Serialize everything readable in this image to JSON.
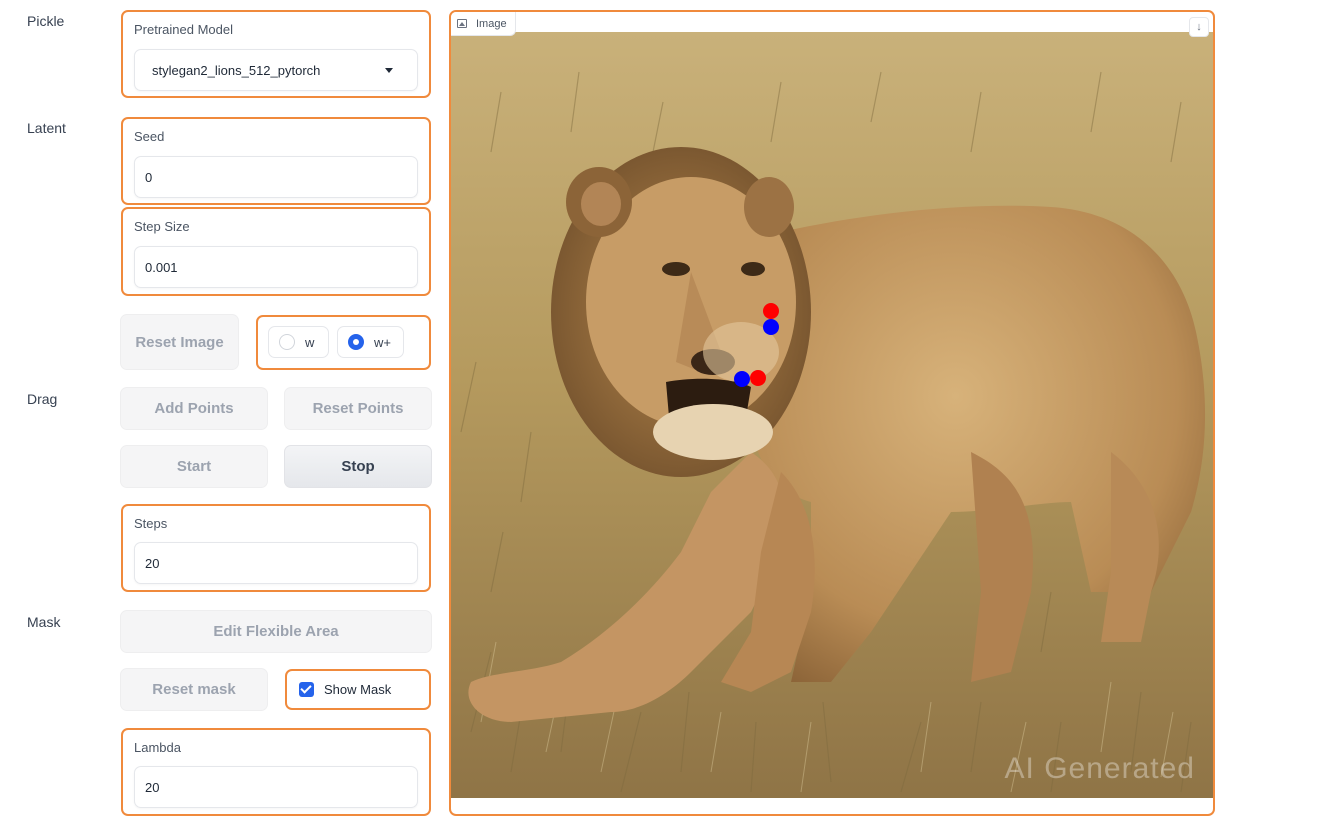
{
  "sections": {
    "pickle": "Pickle",
    "latent": "Latent",
    "drag": "Drag",
    "mask": "Mask"
  },
  "pretrained_model": {
    "label": "Pretrained Model",
    "value": "stylegan2_lions_512_pytorch"
  },
  "seed": {
    "label": "Seed",
    "value": "0"
  },
  "step_size": {
    "label": "Step Size",
    "value": "0.001"
  },
  "reset_image_label": "Reset Image",
  "latent_space": {
    "options": [
      "w",
      "w+"
    ],
    "selected": "w+"
  },
  "add_points_label": "Add Points",
  "reset_points_label": "Reset Points",
  "start_label": "Start",
  "stop_label": "Stop",
  "steps": {
    "label": "Steps",
    "value": "20"
  },
  "edit_flexible_area_label": "Edit Flexible Area",
  "reset_mask_label": "Reset mask",
  "show_mask": {
    "label": "Show Mask",
    "checked": true
  },
  "lambda": {
    "label": "Lambda",
    "value": "20"
  },
  "image_panel": {
    "label": "Image",
    "watermark": "AI Generated",
    "handle_point_color": "#ff0000",
    "target_point_color": "#0000ff"
  },
  "colors": {
    "accent_border": "#f08a3c",
    "selected_blue": "#2563eb"
  }
}
